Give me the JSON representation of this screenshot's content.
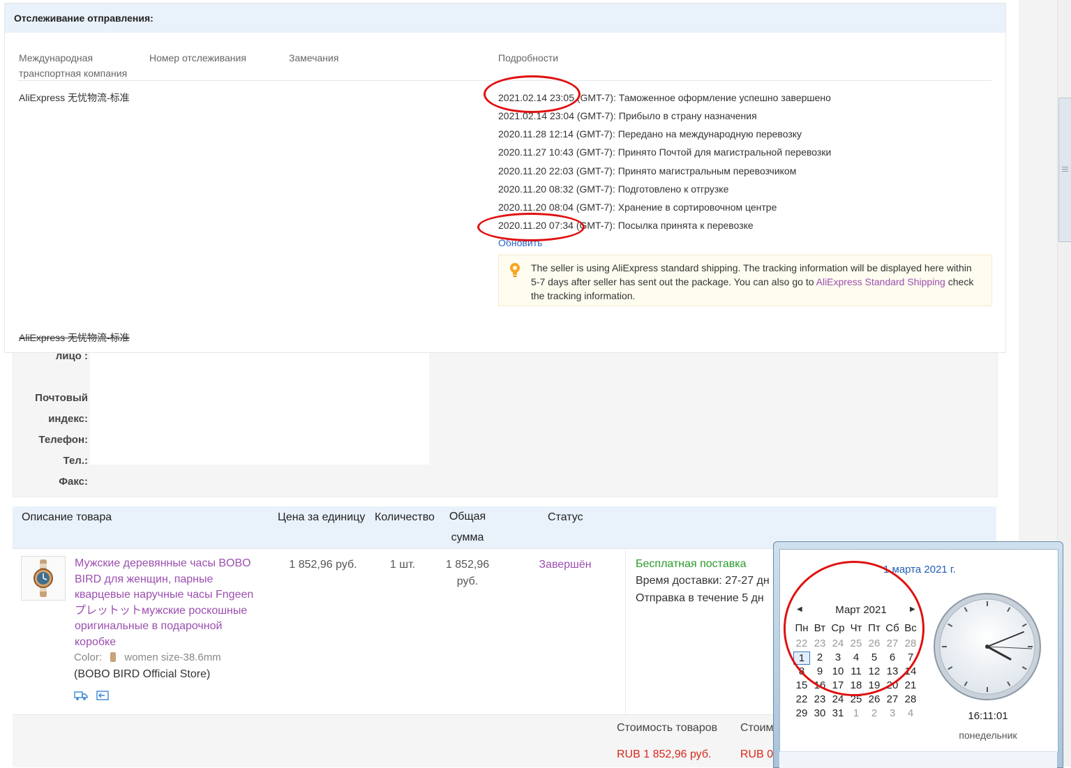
{
  "tracking": {
    "title": "Отслеживание отправления:",
    "columns": {
      "carrier_line1": "Международная",
      "carrier_line2": "транспортная компания",
      "tracking_number": "Номер отслеживания",
      "remarks": "Замечания",
      "details": "Подробности"
    },
    "carrier": "AliExpress 无忧物流-标准",
    "events": [
      "2021.02.14 23:05 (GMT-7): Таможенное оформление успешно завершено",
      "2021.02.14 23:04 (GMT-7): Прибыло в страну назначения",
      "2020.11.28 12:14 (GMT-7): Передано на международную перевозку",
      "2020.11.27 10:43 (GMT-7): Принято Почтой для магистральной перевозки",
      "2020.11.20 22:03 (GMT-7): Принято магистральным перевозчиком",
      "2020.11.20 08:32 (GMT-7): Подготовлено к отгрузке",
      "2020.11.20 08:04 (GMT-7): Хранение в сортировочном центре",
      "2020.11.20 07:34 (GMT-7): Посылка принята к перевозке"
    ],
    "refresh_label": "Обновить",
    "notice": {
      "text_before": "The seller is using AliExpress standard shipping. The tracking information will be displayed here within 5-7 days after seller has sent out the package. You can also go to ",
      "link": "AliExpress Standard Shipping",
      "text_after": " check the tracking information."
    },
    "carrier_strikethrough": "AliExpress 无忧物流-标准"
  },
  "address": {
    "labels": [
      "лицо :",
      "Почтовый",
      "индекс:",
      "Телефон:",
      "Тел.:",
      "Факс:"
    ]
  },
  "order_table": {
    "headers": {
      "description": "Описание товара",
      "unit_price": "Цена за единицу",
      "quantity": "Количество",
      "total_line1": "Общая",
      "total_line2": "сумма",
      "status": "Статус"
    },
    "product": {
      "title": "Мужские деревянные часы BOBO BIRD для женщин, парные кварцевые наручные часы Fngeen プレットットмужские роскошные оригинальные в подарочной коробке",
      "color_label": "Color:",
      "color_value": "women size-38.6mm",
      "store": "(BOBO BIRD Official Store)",
      "unit_price": "1 852,96 руб.",
      "quantity": "1 шт.",
      "total_line1": "1 852,96",
      "total_line2": "руб.",
      "status": "Завершён",
      "shipping": {
        "free": "Бесплатная поставка",
        "delivery_time": "Время доставки: 27-27 дн",
        "dispatch": "Отправка в течение 5 дн"
      }
    },
    "summary": {
      "goods_cost_label": "Стоимость товаров",
      "goods_cost_value": "RUB 1 852,96 руб.",
      "second_label": "Стоим",
      "second_value": "RUB 0"
    }
  },
  "clock_popup": {
    "date_link": "1 марта 2021 г.",
    "month_title": "Март 2021",
    "weekdays": [
      "Пн",
      "Вт",
      "Ср",
      "Чт",
      "Пт",
      "Сб",
      "Вс"
    ],
    "weeks": [
      [
        "22",
        "23",
        "24",
        "25",
        "26",
        "27",
        "28"
      ],
      [
        "1",
        "2",
        "3",
        "4",
        "5",
        "6",
        "7"
      ],
      [
        "8",
        "9",
        "10",
        "11",
        "12",
        "13",
        "14"
      ],
      [
        "15",
        "16",
        "17",
        "18",
        "19",
        "20",
        "21"
      ],
      [
        "22",
        "23",
        "24",
        "25",
        "26",
        "27",
        "28"
      ],
      [
        "29",
        "30",
        "31",
        "1",
        "2",
        "3",
        "4"
      ]
    ],
    "time": "16:11:01",
    "weekday": "понедельник"
  },
  "colors": {
    "link": "#2a62c9",
    "product_link": "#9b4fb0",
    "price_red": "#d9261c",
    "free_shipping_green": "#2b9a2b",
    "annotation_red": "#e01010",
    "header_blue": "#e9f1fb"
  },
  "icons": [
    "notice-bulb-icon",
    "truck-icon",
    "return-icon",
    "calendar-prev-icon",
    "calendar-next-icon",
    "analog-clock-icon",
    "watch-thumbnail-icon"
  ]
}
